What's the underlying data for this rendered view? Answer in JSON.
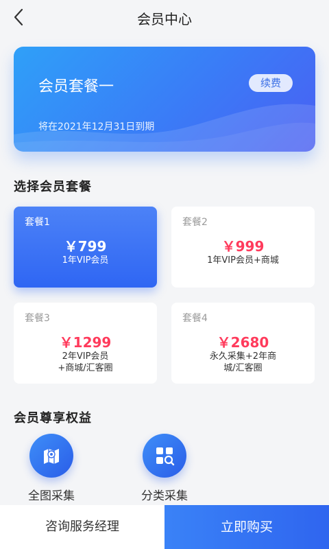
{
  "header": {
    "title": "会员中心",
    "back_icon": "chevron-left-icon"
  },
  "member_card": {
    "title": "会员套餐一",
    "renew_label": "续费",
    "expire_text": "将在2021年12月31日到期",
    "colors": {
      "gradient_start": "#2fa0f8",
      "gradient_end": "#4a5ff2"
    }
  },
  "plans_section": {
    "title": "选择会员套餐",
    "plans": [
      {
        "name": "套餐1",
        "price": "￥799",
        "desc_line1": "1年VIP会员",
        "desc_line2": "",
        "selected": true
      },
      {
        "name": "套餐2",
        "price": "￥999",
        "desc_line1": "1年VIP会员+商城",
        "desc_line2": "",
        "selected": false
      },
      {
        "name": "套餐3",
        "price": "￥1299",
        "desc_line1": "2年VIP会员",
        "desc_line2": "+商城/汇客圈",
        "selected": false
      },
      {
        "name": "套餐4",
        "price": "￥2680",
        "desc_line1": "永久采集+2年商",
        "desc_line2": "城/汇客圈",
        "selected": false
      }
    ],
    "colors": {
      "price": "#ff3b5c",
      "selected_bg": "#3a72f5"
    }
  },
  "benefits_section": {
    "title": "会员尊享权益",
    "items": [
      {
        "label": "全图采集",
        "icon": "map-pin-icon"
      },
      {
        "label": "分类采集",
        "icon": "category-search-icon"
      }
    ]
  },
  "bottom_bar": {
    "consult_label": "咨询服务经理",
    "buy_label": "立即购买"
  }
}
